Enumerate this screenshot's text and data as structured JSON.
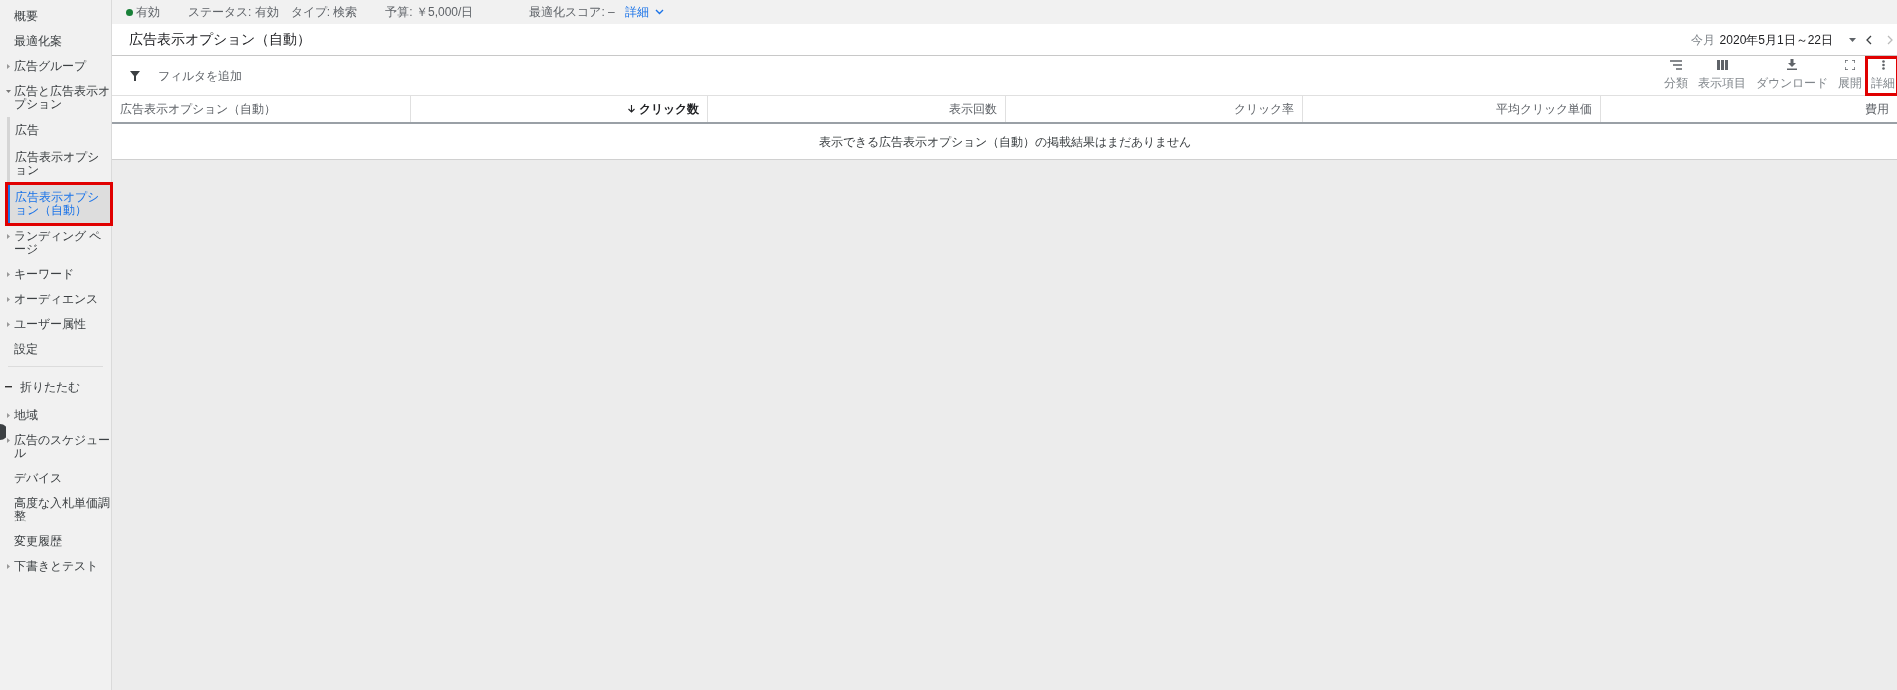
{
  "sidebar": {
    "items": [
      {
        "label": "概要",
        "expandable": false,
        "selected": false
      },
      {
        "label": "最適化案",
        "expandable": false,
        "selected": false
      },
      {
        "label": "広告グループ",
        "expandable": true,
        "expanded": false,
        "selected": false
      },
      {
        "label": "広告と広告表示オプション",
        "expandable": true,
        "expanded": true,
        "selected": false,
        "children": [
          {
            "label": "広告",
            "selected": false
          },
          {
            "label": "広告表示オプション",
            "selected": false
          },
          {
            "label": "広告表示オプション（自動）",
            "selected": true
          }
        ]
      },
      {
        "label": "ランディング ページ",
        "expandable": true,
        "expanded": false,
        "selected": false
      },
      {
        "label": "キーワード",
        "expandable": true,
        "expanded": false,
        "selected": false
      },
      {
        "label": "オーディエンス",
        "expandable": true,
        "expanded": false,
        "selected": false
      },
      {
        "label": "ユーザー属性",
        "expandable": true,
        "expanded": false,
        "selected": false
      },
      {
        "label": "設定",
        "expandable": false,
        "selected": false
      }
    ],
    "collapse": "折りたたむ",
    "more_items": [
      {
        "label": "地域",
        "expandable": true
      },
      {
        "label": "広告のスケジュール",
        "expandable": true
      },
      {
        "label": "デバイス",
        "expandable": false
      },
      {
        "label": "高度な入札単価調整",
        "expandable": false
      },
      {
        "label": "変更履歴",
        "expandable": false
      },
      {
        "label": "下書きとテスト",
        "expandable": true
      }
    ]
  },
  "status_bar": {
    "status": "有効",
    "color": "#188038",
    "items": [
      "ステータス: 有効",
      "タイプ: 検索",
      "予算: ￥5,000/日",
      "最適化スコア: –"
    ],
    "details": "詳細"
  },
  "title": "広告表示オプション（自動）",
  "date_range": {
    "label": "今月",
    "value": "2020年5月1日～22日"
  },
  "filter": "フィルタを追加",
  "toolbar": [
    {
      "kind": "segment",
      "label": "分類"
    },
    {
      "kind": "columns",
      "label": "表示項目"
    },
    {
      "kind": "download",
      "label": "ダウンロード"
    },
    {
      "kind": "expand",
      "label": "展開"
    },
    {
      "kind": "more",
      "label": "詳細"
    }
  ],
  "table": {
    "columns": [
      {
        "label": "広告表示オプション（自動）",
        "sorted": false
      },
      {
        "label": "クリック数",
        "sorted": true
      },
      {
        "label": "表示回数",
        "sorted": false
      },
      {
        "label": "クリック率",
        "sorted": false
      },
      {
        "label": "平均クリック単価",
        "sorted": false
      },
      {
        "label": "費用",
        "sorted": false
      }
    ],
    "empty_message": "表示できる広告表示オプション（自動）の掲載結果はまだありません"
  }
}
